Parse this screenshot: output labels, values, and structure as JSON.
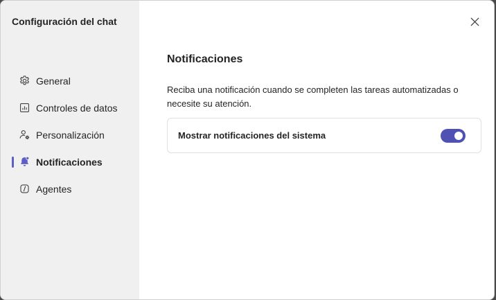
{
  "sidebar": {
    "title": "Configuración del chat",
    "items": [
      {
        "label": "General",
        "icon": "gear-icon",
        "active": false
      },
      {
        "label": "Controles de datos",
        "icon": "chart-icon",
        "active": false
      },
      {
        "label": "Personalización",
        "icon": "person-settings-icon",
        "active": false
      },
      {
        "label": "Notificaciones",
        "icon": "bell-icon",
        "active": true
      },
      {
        "label": "Agentes",
        "icon": "agent-icon",
        "active": false
      }
    ]
  },
  "main": {
    "close_icon": "close-icon",
    "section_title": "Notificaciones",
    "description": "Reciba una notificación cuando se completen las tareas automatizadas o necesite su atención.",
    "setting": {
      "label": "Mostrar notificaciones del sistema",
      "enabled": true
    }
  },
  "colors": {
    "accent": "#5b5fc7",
    "toggle_on": "#4f52b2",
    "sidebar_bg": "#f0f0f0"
  }
}
